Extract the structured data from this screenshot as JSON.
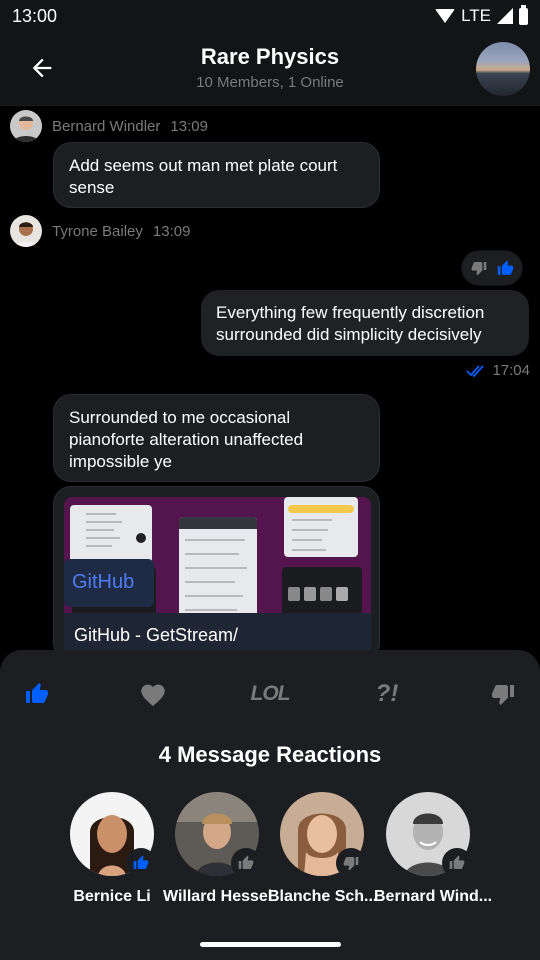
{
  "status": {
    "time": "13:00",
    "network": "LTE"
  },
  "header": {
    "title": "Rare Physics",
    "subtitle": "10 Members, 1 Online"
  },
  "messages": [
    {
      "author": "Bernard Windler",
      "time": "13:09",
      "text": "Add seems out man met plate court sense"
    },
    {
      "author": "Tyrone Bailey",
      "time": "13:09"
    },
    {
      "text": "Everything few frequently discretion surrounded did simplicity decisively",
      "time": "17:04"
    },
    {
      "text": "Surrounded to me occasional pianoforte alteration unaffected impossible ye"
    }
  ],
  "attachment": {
    "site": "GitHub",
    "title": "GitHub - GetStream/"
  },
  "sheet": {
    "title": "4 Message Reactions",
    "tabs": [
      {
        "icon": "thumbs-up-icon",
        "active": true
      },
      {
        "icon": "heart-icon"
      },
      {
        "label": "LOL"
      },
      {
        "label": "?!"
      },
      {
        "icon": "thumbs-down-icon"
      }
    ],
    "users": [
      {
        "name": "Bernice Li",
        "reaction": "thumbs-up",
        "highlight": true
      },
      {
        "name": "Willard Hessel",
        "reaction": "thumbs-up"
      },
      {
        "name": "Blanche Sch...",
        "reaction": "thumbs-down"
      },
      {
        "name": "Bernard Wind...",
        "reaction": "thumbs-up"
      }
    ]
  },
  "colors": {
    "accent": "#005fff",
    "background": "#000000",
    "surface": "#1c1e22",
    "muted": "#7a7a7a"
  }
}
